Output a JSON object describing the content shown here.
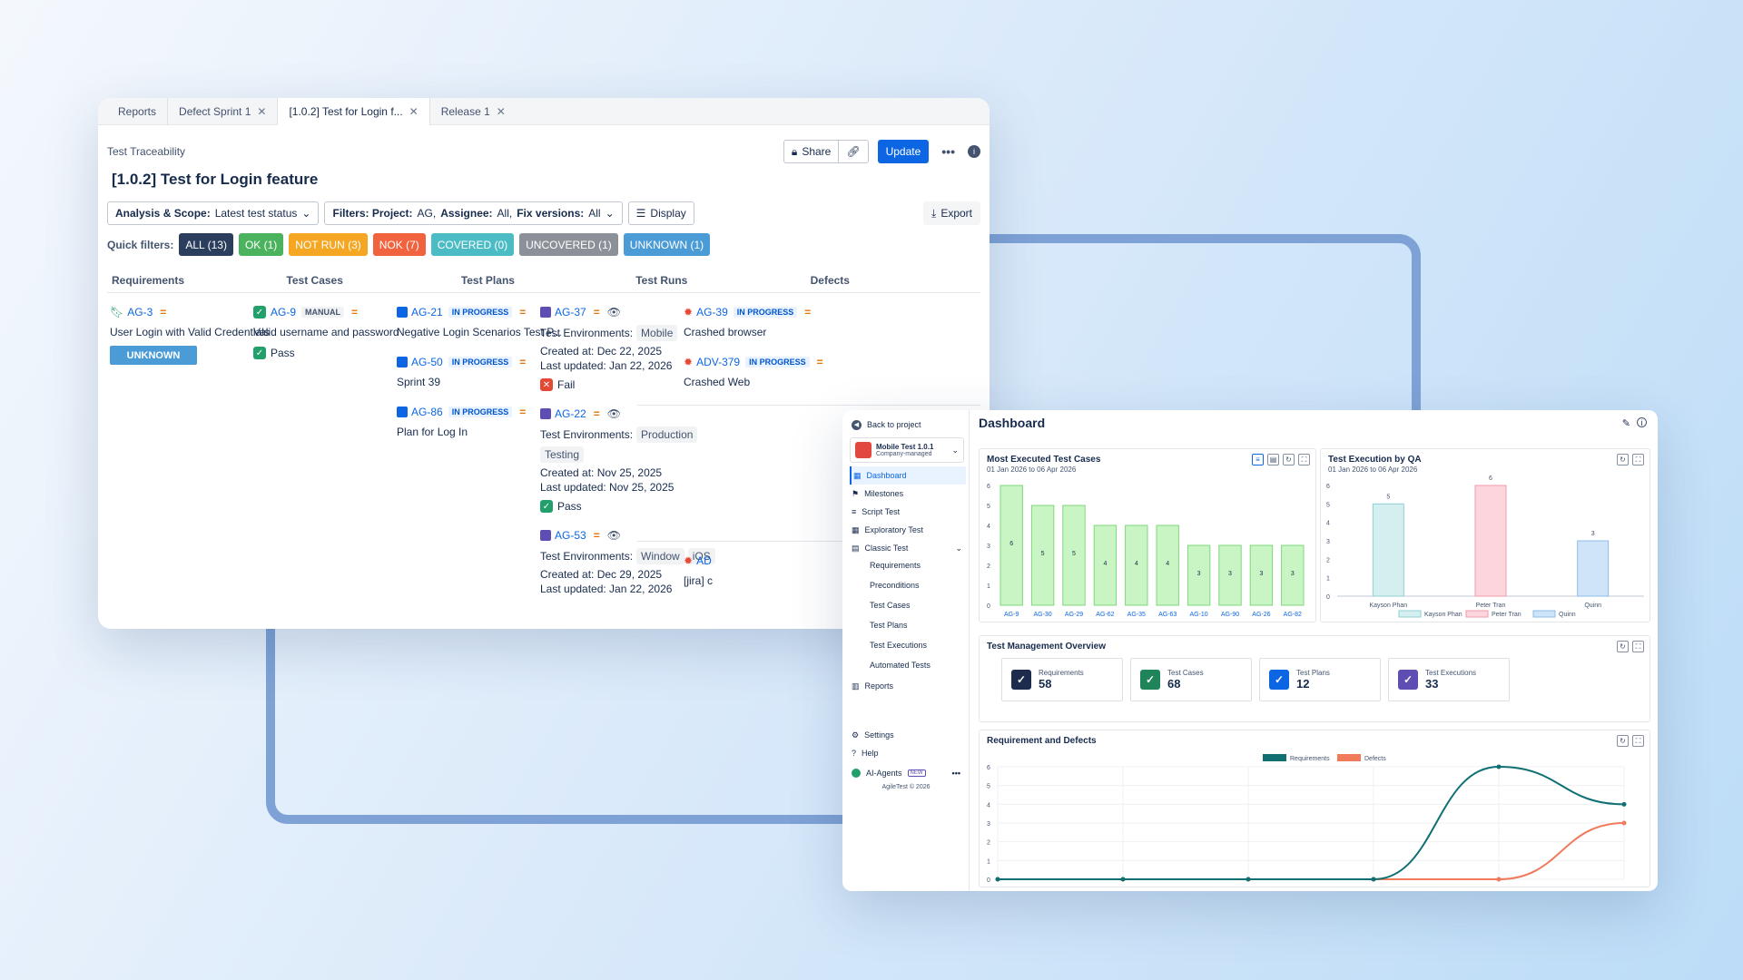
{
  "tabs": [
    {
      "label": "Reports"
    },
    {
      "label": "Defect Sprint 1"
    },
    {
      "label": "[1.0.2] Test for Login f..."
    },
    {
      "label": "Release 1"
    }
  ],
  "header": {
    "breadcrumb": "Test Traceability",
    "share": "Share",
    "update": "Update",
    "title": "[1.0.2] Test for Login feature"
  },
  "filters": {
    "analysis_label": "Analysis & Scope:",
    "analysis_value": "Latest test status",
    "filters_label": "Filters: Project:",
    "project": "AG,",
    "assignee_label": "Assignee:",
    "assignee": "All,",
    "fix_label": "Fix versions:",
    "fix": "All",
    "display": "Display",
    "export": "Export"
  },
  "quick_filters": {
    "label": "Quick filters:",
    "chips": [
      {
        "label": "ALL (13)",
        "color": "#2c3e5d"
      },
      {
        "label": "OK (1)",
        "color": "#4bb35e"
      },
      {
        "label": "NOT RUN (3)",
        "color": "#f5a623"
      },
      {
        "label": "NOK (7)",
        "color": "#f0633e"
      },
      {
        "label": "COVERED (0)",
        "color": "#4cbcc4"
      },
      {
        "label": "UNCOVERED (1)",
        "color": "#8c9199"
      },
      {
        "label": "UNKNOWN (1)",
        "color": "#4a9bd6"
      }
    ]
  },
  "columns": [
    "Requirements",
    "Test Cases",
    "Test Plans",
    "Test Runs",
    "Defects"
  ],
  "requirement": {
    "key": "AG-3",
    "summary": "User Login with Valid Credentials",
    "status": "UNKNOWN"
  },
  "testcase": {
    "key": "AG-9",
    "type": "MANUAL",
    "summary": "Valid username and password",
    "result": "Pass"
  },
  "plans": [
    {
      "key": "AG-21",
      "status": "IN PROGRESS",
      "summary": "Negative Login Scenarios Test P..."
    },
    {
      "key": "AG-50",
      "status": "IN PROGRESS",
      "summary": "Sprint 39"
    },
    {
      "key": "AG-86",
      "status": "IN PROGRESS",
      "summary": "Plan for Log In"
    }
  ],
  "runs": [
    {
      "key": "AG-37",
      "env_label": "Test Environments:",
      "env": [
        "Mobile"
      ],
      "created": "Created at: Dec 22, 2025",
      "updated": "Last updated: Jan 22, 2026",
      "result": "Fail"
    },
    {
      "key": "AG-22",
      "env_label": "Test Environments:",
      "env": [
        "Production",
        "Testing"
      ],
      "created": "Created at: Nov 25, 2025",
      "updated": "Last updated: Nov 25, 2025",
      "result": "Pass"
    },
    {
      "key": "AG-53",
      "env_label": "Test Environments:",
      "env": [
        "Window",
        "iOS"
      ],
      "created": "Created at: Dec 29, 2025",
      "updated": "Last updated: Jan 22, 2026"
    }
  ],
  "defects": [
    {
      "key": "AG-39",
      "status": "IN PROGRESS",
      "summary": "Crashed browser"
    },
    {
      "key": "ADV-379",
      "status": "IN PROGRESS",
      "summary": "Crashed Web"
    },
    {
      "key": "AD",
      "summary": "[jira] c"
    }
  ],
  "dashboard": {
    "back": "Back to project",
    "project": "Mobile Test 1.0.1",
    "project_sub": "Company-managed",
    "title": "Dashboard",
    "nav": [
      "Dashboard",
      "Milestones",
      "Script Test",
      "Exploratory Test",
      "Classic Test"
    ],
    "subnav": [
      "Requirements",
      "Preconditions",
      "Test Cases",
      "Test Plans",
      "Test Executions",
      "Automated Tests"
    ],
    "reports": "Reports",
    "settings": "Settings",
    "help": "Help",
    "ai": "AI-Agents",
    "ai_badge": "NEW",
    "footer": "AgileTest © 2026",
    "mostExec": {
      "title": "Most Executed Test Cases",
      "range": "01 Jan 2026 to 06 Apr 2026"
    },
    "byQA": {
      "title": "Test Execution by QA",
      "range": "01 Jan 2026 to 06 Apr 2026"
    },
    "overview": {
      "title": "Test Management Overview",
      "stats": [
        {
          "label": "Requirements",
          "value": "58",
          "color": "#1d2b4c"
        },
        {
          "label": "Test Cases",
          "value": "68",
          "color": "#1f845a"
        },
        {
          "label": "Test Plans",
          "value": "12",
          "color": "#0c66e4"
        },
        {
          "label": "Test Executions",
          "value": "33",
          "color": "#5e4db2"
        }
      ]
    },
    "reqdef": {
      "title": "Requirement and Defects"
    }
  },
  "chart_data": [
    {
      "type": "bar",
      "title": "Most Executed Test Cases",
      "categories": [
        "AG-9",
        "AG-30",
        "AG-29",
        "AG-62",
        "AG-35",
        "AG-63",
        "AG-10",
        "AG-90",
        "AG-26",
        "AG-82"
      ],
      "values": [
        6,
        5,
        5,
        4,
        4,
        4,
        3,
        3,
        3,
        3
      ],
      "ylim": [
        0,
        6
      ],
      "color": "#c9f5c4"
    },
    {
      "type": "bar",
      "title": "Test Execution by QA",
      "categories": [
        "Kayson Phan",
        "Peter Tran",
        "Quinn"
      ],
      "values": [
        5,
        6,
        3
      ],
      "ylim": [
        0,
        6
      ],
      "colors": [
        "#d4eff0",
        "#fcd6dc",
        "#cfe4f8"
      ],
      "legend": [
        "Kayson Phan",
        "Peter Tran",
        "Quinn"
      ]
    },
    {
      "type": "line",
      "title": "Requirement and Defects",
      "ylim": [
        0,
        6
      ],
      "series": [
        {
          "name": "Requirements",
          "values": [
            0,
            0,
            0,
            0,
            6,
            4
          ],
          "color": "#0f6f73"
        },
        {
          "name": "Defects",
          "values": [
            0,
            0,
            0,
            0,
            0,
            3
          ],
          "color": "#f07a5a"
        }
      ]
    }
  ]
}
